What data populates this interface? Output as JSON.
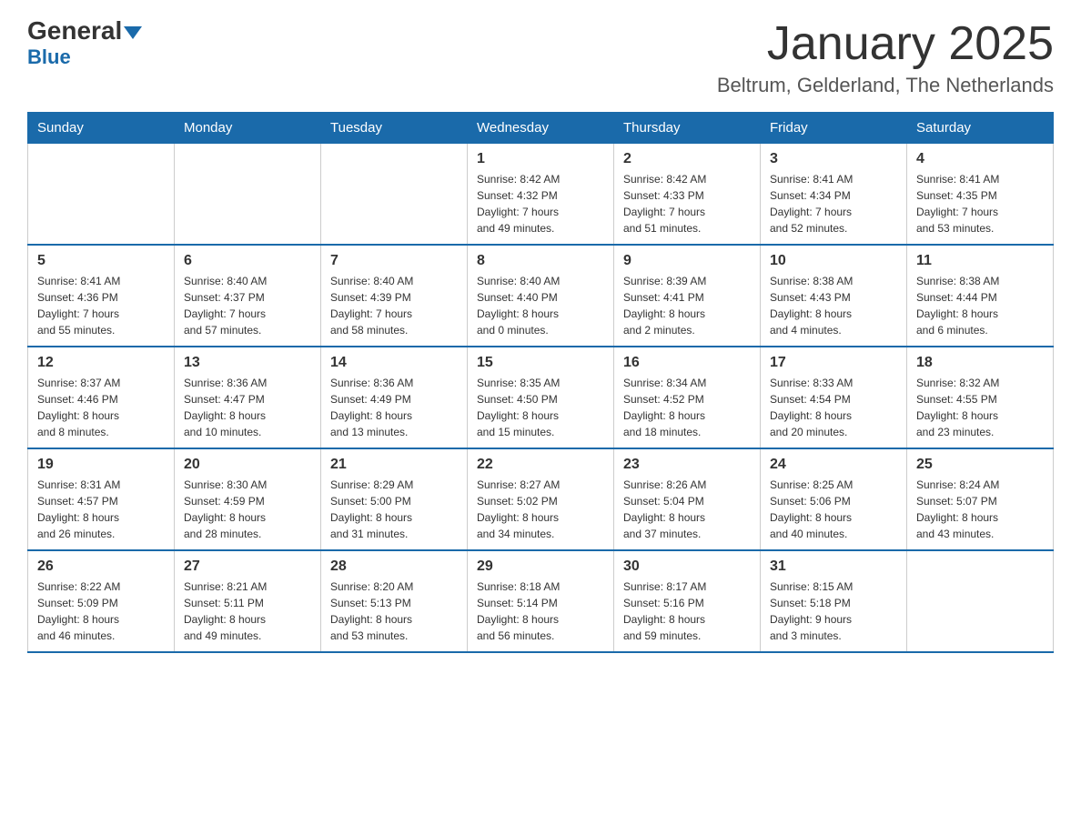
{
  "header": {
    "logo_main": "General",
    "logo_sub": "Blue",
    "month_title": "January 2025",
    "location": "Beltrum, Gelderland, The Netherlands"
  },
  "days_of_week": [
    "Sunday",
    "Monday",
    "Tuesday",
    "Wednesday",
    "Thursday",
    "Friday",
    "Saturday"
  ],
  "weeks": [
    [
      {
        "day": "",
        "info": ""
      },
      {
        "day": "",
        "info": ""
      },
      {
        "day": "",
        "info": ""
      },
      {
        "day": "1",
        "info": "Sunrise: 8:42 AM\nSunset: 4:32 PM\nDaylight: 7 hours\nand 49 minutes."
      },
      {
        "day": "2",
        "info": "Sunrise: 8:42 AM\nSunset: 4:33 PM\nDaylight: 7 hours\nand 51 minutes."
      },
      {
        "day": "3",
        "info": "Sunrise: 8:41 AM\nSunset: 4:34 PM\nDaylight: 7 hours\nand 52 minutes."
      },
      {
        "day": "4",
        "info": "Sunrise: 8:41 AM\nSunset: 4:35 PM\nDaylight: 7 hours\nand 53 minutes."
      }
    ],
    [
      {
        "day": "5",
        "info": "Sunrise: 8:41 AM\nSunset: 4:36 PM\nDaylight: 7 hours\nand 55 minutes."
      },
      {
        "day": "6",
        "info": "Sunrise: 8:40 AM\nSunset: 4:37 PM\nDaylight: 7 hours\nand 57 minutes."
      },
      {
        "day": "7",
        "info": "Sunrise: 8:40 AM\nSunset: 4:39 PM\nDaylight: 7 hours\nand 58 minutes."
      },
      {
        "day": "8",
        "info": "Sunrise: 8:40 AM\nSunset: 4:40 PM\nDaylight: 8 hours\nand 0 minutes."
      },
      {
        "day": "9",
        "info": "Sunrise: 8:39 AM\nSunset: 4:41 PM\nDaylight: 8 hours\nand 2 minutes."
      },
      {
        "day": "10",
        "info": "Sunrise: 8:38 AM\nSunset: 4:43 PM\nDaylight: 8 hours\nand 4 minutes."
      },
      {
        "day": "11",
        "info": "Sunrise: 8:38 AM\nSunset: 4:44 PM\nDaylight: 8 hours\nand 6 minutes."
      }
    ],
    [
      {
        "day": "12",
        "info": "Sunrise: 8:37 AM\nSunset: 4:46 PM\nDaylight: 8 hours\nand 8 minutes."
      },
      {
        "day": "13",
        "info": "Sunrise: 8:36 AM\nSunset: 4:47 PM\nDaylight: 8 hours\nand 10 minutes."
      },
      {
        "day": "14",
        "info": "Sunrise: 8:36 AM\nSunset: 4:49 PM\nDaylight: 8 hours\nand 13 minutes."
      },
      {
        "day": "15",
        "info": "Sunrise: 8:35 AM\nSunset: 4:50 PM\nDaylight: 8 hours\nand 15 minutes."
      },
      {
        "day": "16",
        "info": "Sunrise: 8:34 AM\nSunset: 4:52 PM\nDaylight: 8 hours\nand 18 minutes."
      },
      {
        "day": "17",
        "info": "Sunrise: 8:33 AM\nSunset: 4:54 PM\nDaylight: 8 hours\nand 20 minutes."
      },
      {
        "day": "18",
        "info": "Sunrise: 8:32 AM\nSunset: 4:55 PM\nDaylight: 8 hours\nand 23 minutes."
      }
    ],
    [
      {
        "day": "19",
        "info": "Sunrise: 8:31 AM\nSunset: 4:57 PM\nDaylight: 8 hours\nand 26 minutes."
      },
      {
        "day": "20",
        "info": "Sunrise: 8:30 AM\nSunset: 4:59 PM\nDaylight: 8 hours\nand 28 minutes."
      },
      {
        "day": "21",
        "info": "Sunrise: 8:29 AM\nSunset: 5:00 PM\nDaylight: 8 hours\nand 31 minutes."
      },
      {
        "day": "22",
        "info": "Sunrise: 8:27 AM\nSunset: 5:02 PM\nDaylight: 8 hours\nand 34 minutes."
      },
      {
        "day": "23",
        "info": "Sunrise: 8:26 AM\nSunset: 5:04 PM\nDaylight: 8 hours\nand 37 minutes."
      },
      {
        "day": "24",
        "info": "Sunrise: 8:25 AM\nSunset: 5:06 PM\nDaylight: 8 hours\nand 40 minutes."
      },
      {
        "day": "25",
        "info": "Sunrise: 8:24 AM\nSunset: 5:07 PM\nDaylight: 8 hours\nand 43 minutes."
      }
    ],
    [
      {
        "day": "26",
        "info": "Sunrise: 8:22 AM\nSunset: 5:09 PM\nDaylight: 8 hours\nand 46 minutes."
      },
      {
        "day": "27",
        "info": "Sunrise: 8:21 AM\nSunset: 5:11 PM\nDaylight: 8 hours\nand 49 minutes."
      },
      {
        "day": "28",
        "info": "Sunrise: 8:20 AM\nSunset: 5:13 PM\nDaylight: 8 hours\nand 53 minutes."
      },
      {
        "day": "29",
        "info": "Sunrise: 8:18 AM\nSunset: 5:14 PM\nDaylight: 8 hours\nand 56 minutes."
      },
      {
        "day": "30",
        "info": "Sunrise: 8:17 AM\nSunset: 5:16 PM\nDaylight: 8 hours\nand 59 minutes."
      },
      {
        "day": "31",
        "info": "Sunrise: 8:15 AM\nSunset: 5:18 PM\nDaylight: 9 hours\nand 3 minutes."
      },
      {
        "day": "",
        "info": ""
      }
    ]
  ]
}
